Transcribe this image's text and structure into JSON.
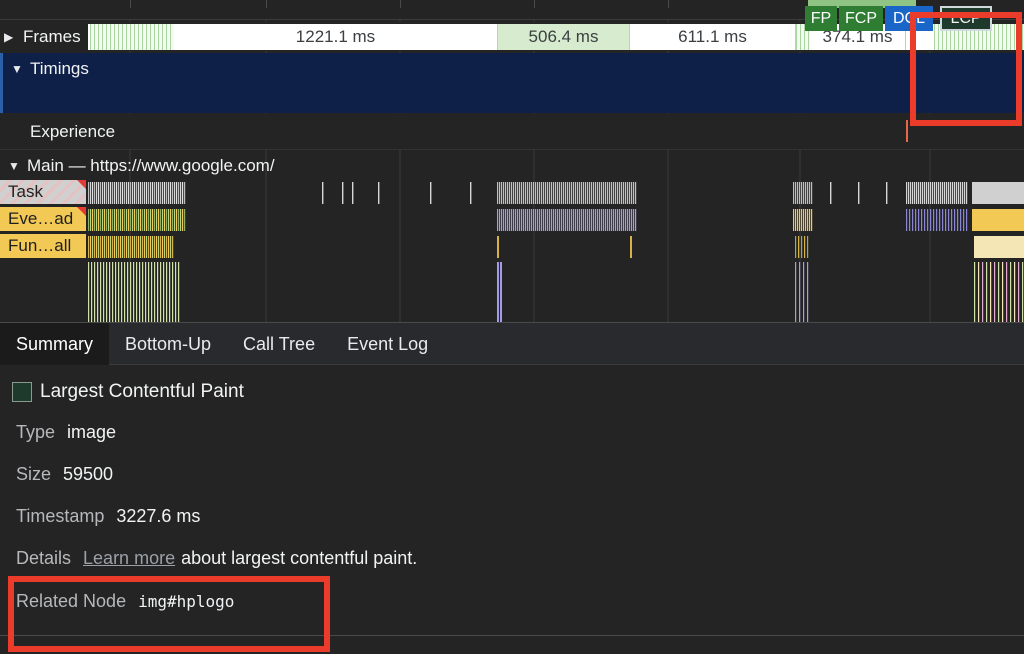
{
  "timeline": {
    "frames_label": "Frames",
    "frame_durations": [
      "1221.1 ms",
      "506.4 ms",
      "611.1 ms",
      "374.1 ms"
    ],
    "timings_label": "Timings",
    "markers": {
      "fp": "FP",
      "fcp": "FCP",
      "dcl": "DCL",
      "lcp": "LCP"
    },
    "experience_label": "Experience",
    "main_label": "Main — https://www.google.com/",
    "tracks": {
      "task": "Task",
      "event": "Eve…ad",
      "function": "Fun…all"
    }
  },
  "tabs": [
    "Summary",
    "Bottom-Up",
    "Call Tree",
    "Event Log"
  ],
  "summary": {
    "title": "Largest Contentful Paint",
    "type_key": "Type",
    "type_value": "image",
    "size_key": "Size",
    "size_value": "59500",
    "timestamp_key": "Timestamp",
    "timestamp_value": "3227.6 ms",
    "details_key": "Details",
    "details_link": "Learn more",
    "details_text": "about largest contentful paint.",
    "related_node_key": "Related Node",
    "related_node_value": "img#hplogo"
  },
  "colors": {
    "highlight": "#ea3b2b",
    "timings_bg": "#0f2048",
    "fp_fcp": "#2e7d32",
    "dcl": "#1a66c8",
    "task_yellow": "#f2c955"
  }
}
